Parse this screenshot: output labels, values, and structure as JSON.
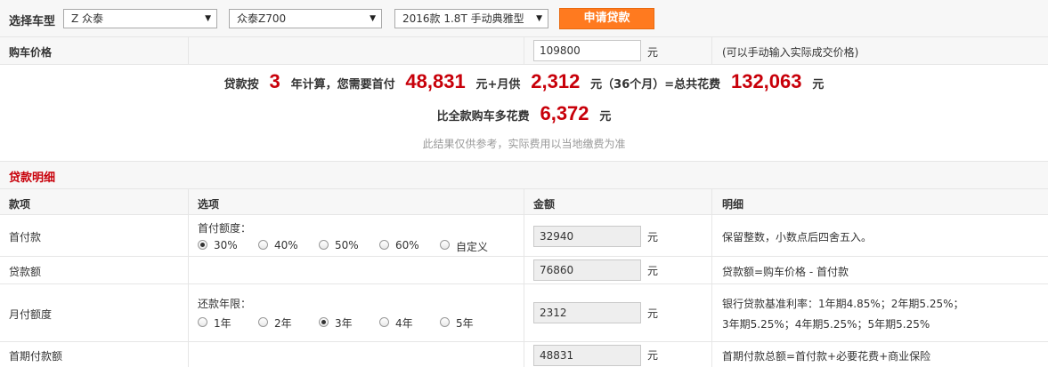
{
  "selector": {
    "label": "选择车型",
    "brand": "Z 众泰",
    "series": "众泰Z700",
    "model": "2016款 1.8T 手动典雅型",
    "apply_button": "申请贷款"
  },
  "price_row": {
    "label": "购车价格",
    "value": "109800",
    "unit": "元",
    "hint": "(可以手动输入实际成交价格)"
  },
  "summary": {
    "line1_a": "贷款按",
    "years": "3",
    "line1_b": "年计算，您需要首付",
    "down_payment": "48,831",
    "line1_c": "元+月供",
    "monthly": "2,312",
    "line1_d": "元（36个月）=总共花费",
    "total": "132,063",
    "line1_e": "元",
    "line2_a": "比全款购车多花费",
    "extra": "6,372",
    "line2_b": "元",
    "note": "此结果仅供参考，实际费用以当地缴费为准"
  },
  "section_title": "贷款明细",
  "table": {
    "headers": [
      "款项",
      "选项",
      "金额",
      "明细"
    ],
    "rows": {
      "down": {
        "name": "首付款",
        "option_label": "首付额度：",
        "options": [
          "30%",
          "40%",
          "50%",
          "60%",
          "自定义"
        ],
        "selected": "30%",
        "amount": "32940",
        "unit": "元",
        "detail": "保留整数，小数点后四舍五入。"
      },
      "loan": {
        "name": "贷款额",
        "amount": "76860",
        "unit": "元",
        "detail": "贷款额=购车价格 - 首付款"
      },
      "monthly": {
        "name": "月付额度",
        "option_label": "还款年限：",
        "options": [
          "1年",
          "2年",
          "3年",
          "4年",
          "5年"
        ],
        "selected": "3年",
        "amount": "2312",
        "unit": "元",
        "detail_1": "银行贷款基准利率：1年期4.85%；2年期5.25%；",
        "detail_2": "3年期5.25%；4年期5.25%；5年期5.25%"
      },
      "first": {
        "name": "首期付款额",
        "amount": "48831",
        "unit": "元",
        "detail": "首期付款总额=首付款+必要花费+商业保险"
      }
    }
  },
  "colors": {
    "accent_red": "#c8000a",
    "button_orange": "#ff7a1f"
  }
}
